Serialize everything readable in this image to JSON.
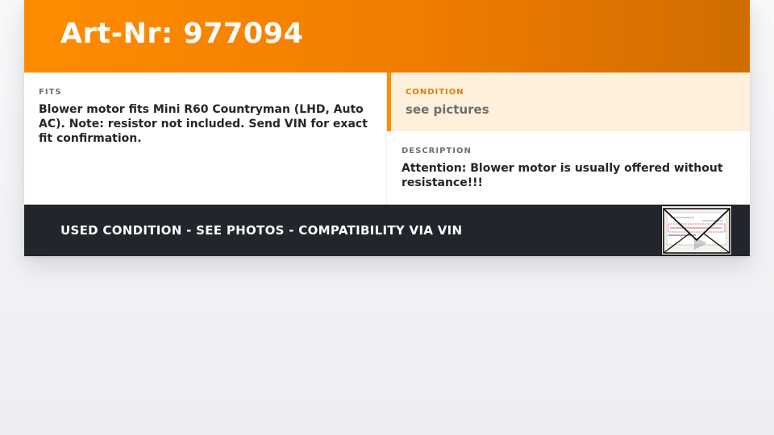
{
  "header": {
    "title": "Art-Nr: 977094"
  },
  "fits": {
    "label": "FITS",
    "text": "Blower motor fits Mini R60 Countryman (LHD, Auto AC). Note: resistor not included. Send VIN for exact fit confirmation."
  },
  "condition": {
    "label": "CONDITION",
    "text": "see pictures"
  },
  "description": {
    "label": "DESCRIPTION",
    "text": "Attention: Blower motor is usually offered without resistance!!!"
  },
  "footer": {
    "banner": "USED CONDITION - SEE PHOTOS - COMPATIBILITY VIA VIN",
    "thumbnail_icon": "envelope-photo-icon"
  },
  "colors": {
    "accent": "#ff8c00",
    "accent_dark": "#cf6d00",
    "condition_bg": "#fff0dc",
    "footer_bg": "#22262c",
    "text_dark": "#23262b",
    "label_gray": "#6b7078"
  }
}
